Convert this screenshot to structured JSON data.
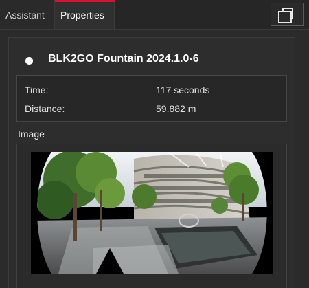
{
  "tabs": {
    "assistant": "Assistant",
    "properties": "Properties"
  },
  "header": {
    "restore_button": "window-restore-icon"
  },
  "scan": {
    "name": "BLK2GO Fountain 2024.1.0-6",
    "status_color": "#ffffff"
  },
  "details": {
    "time_label": "Time:",
    "time_value": "117 seconds",
    "distance_label": "Distance:",
    "distance_value": "59.882 m"
  },
  "image_section": {
    "label": "Image"
  },
  "colors": {
    "accent": "#d9112c",
    "background": "#2b2b2b",
    "text": "#e6e6e6"
  }
}
